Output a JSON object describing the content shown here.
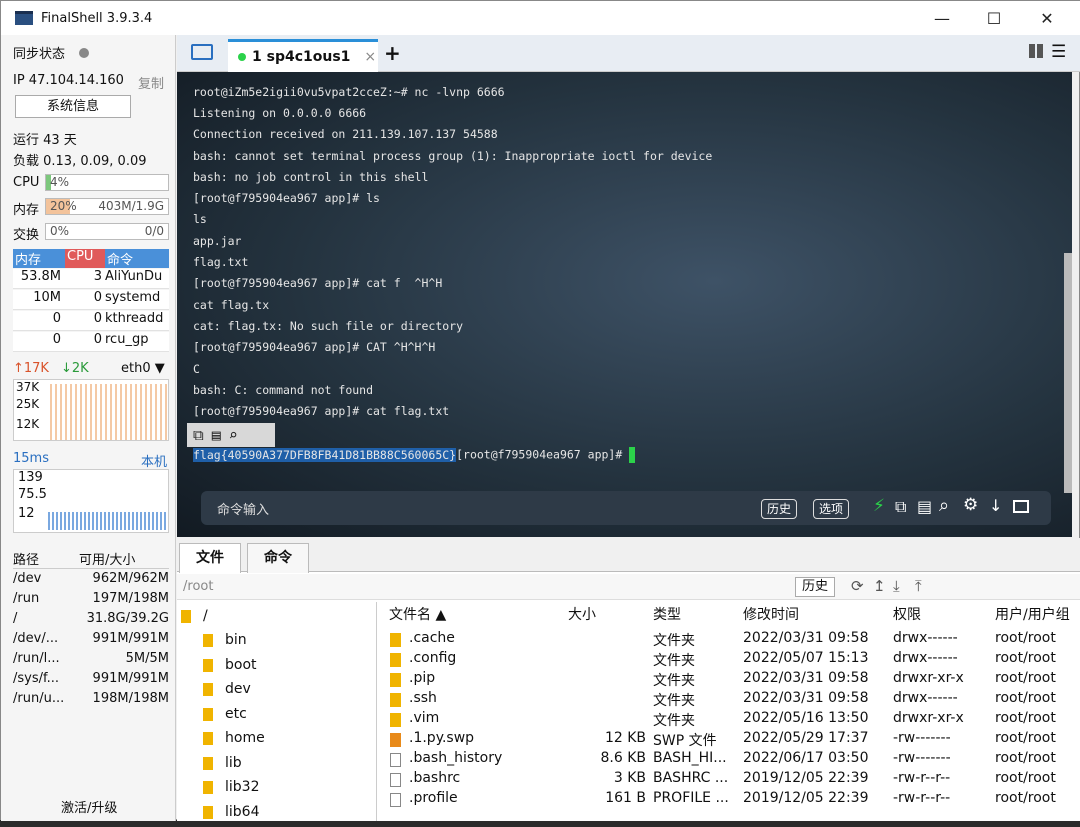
{
  "window": {
    "title": "FinalShell 3.9.3.4",
    "minimize": "—",
    "maximize": "☐",
    "close": "✕"
  },
  "left": {
    "sync_label": "同步状态",
    "ip": "IP 47.104.14.160",
    "copy_label": "复制",
    "sysinfo_button": "系统信息",
    "uptime": "运行 43 天",
    "load": "负载 0.13, 0.09, 0.09",
    "cpu_label": "CPU",
    "cpu_value": "4%",
    "cpu_fraction": 0.04,
    "mem_label": "内存",
    "mem_percent": "20%",
    "mem_usage": "403M/1.9G",
    "mem_fraction": 0.2,
    "swap_label": "交换",
    "swap_percent": "0%",
    "swap_usage": "0/0",
    "proc_headers": [
      "内存",
      "CPU",
      "命令"
    ],
    "processes": [
      {
        "mem": "53.8M",
        "cpu": "3",
        "cmd": "AliYunDu"
      },
      {
        "mem": "10M",
        "cpu": "0",
        "cmd": "systemd"
      },
      {
        "mem": "0",
        "cpu": "0",
        "cmd": "kthreadd"
      },
      {
        "mem": "0",
        "cpu": "0",
        "cmd": "rcu_gp"
      }
    ],
    "net_up": "↑17K",
    "net_down": "↓2K",
    "net_iface": "eth0",
    "net_ticks": [
      "37K",
      "25K",
      "12K"
    ],
    "latency": "15ms",
    "latency_target": "本机",
    "latency_ticks": [
      "139",
      "75.5",
      "12"
    ],
    "disk_headers": [
      "路径",
      "可用/大小"
    ],
    "disks": [
      {
        "path": "/dev",
        "size": "962M/962M"
      },
      {
        "path": "/run",
        "size": "197M/198M"
      },
      {
        "path": "/",
        "size": "31.8G/39.2G"
      },
      {
        "path": "/dev/...",
        "size": "991M/991M"
      },
      {
        "path": "/run/l...",
        "size": "5M/5M"
      },
      {
        "path": "/sys/f...",
        "size": "991M/991M"
      },
      {
        "path": "/run/u...",
        "size": "198M/198M"
      }
    ],
    "activate_label": "激活/升级"
  },
  "tabs": [
    {
      "label": "1 sp4c1ous1"
    }
  ],
  "terminal": {
    "lines": [
      "root@iZm5e2igii0vu5vpat2cceZ:~# nc -lvnp 6666",
      "Listening on 0.0.0.0 6666",
      "Connection received on 211.139.107.137 54588",
      "bash: cannot set terminal process group (1): Inappropriate ioctl for device",
      "bash: no job control in this shell",
      "[root@f795904ea967 app]# ls",
      "ls",
      "app.jar",
      "flag.txt",
      "[root@f795904ea967 app]# cat f  ^H^H",
      "cat flag.tx",
      "cat: flag.tx: No such file or directory",
      "[root@f795904ea967 app]# CAT ^H^H^H",
      "C",
      "bash: C: command not found",
      "[root@f795904ea967 app]# cat flag.txt"
    ],
    "flag": "flag{40590A377DFB8FB41D81BB88C560065C}",
    "prompt_tail": "[root@f795904ea967 app]# ",
    "command_input_label": "命令输入",
    "history_button": "历史",
    "options_button": "选项"
  },
  "filepane": {
    "tabs": [
      "文件",
      "命令"
    ],
    "path": "/root",
    "history_button": "历史",
    "tree": [
      "/",
      "bin",
      "boot",
      "dev",
      "etc",
      "home",
      "lib",
      "lib32",
      "lib64"
    ],
    "headers": [
      "文件名 ▲",
      "大小",
      "类型",
      "修改时间",
      "权限",
      "用户/用户组"
    ],
    "files": [
      {
        "name": ".cache",
        "size": "",
        "type": "文件夹",
        "mtime": "2022/03/31 09:58",
        "perm": "drwx------",
        "owner": "root/root",
        "icon": "folder-icon"
      },
      {
        "name": ".config",
        "size": "",
        "type": "文件夹",
        "mtime": "2022/05/07 15:13",
        "perm": "drwx------",
        "owner": "root/root",
        "icon": "folder-icon"
      },
      {
        "name": ".pip",
        "size": "",
        "type": "文件夹",
        "mtime": "2022/03/31 09:58",
        "perm": "drwxr-xr-x",
        "owner": "root/root",
        "icon": "folder-icon"
      },
      {
        "name": ".ssh",
        "size": "",
        "type": "文件夹",
        "mtime": "2022/03/31 09:58",
        "perm": "drwx------",
        "owner": "root/root",
        "icon": "folder-icon"
      },
      {
        "name": ".vim",
        "size": "",
        "type": "文件夹",
        "mtime": "2022/05/16 13:50",
        "perm": "drwxr-xr-x",
        "owner": "root/root",
        "icon": "folder-icon"
      },
      {
        "name": ".1.py.swp",
        "size": "12 KB",
        "type": "SWP 文件",
        "mtime": "2022/05/29 17:37",
        "perm": "-rw-------",
        "owner": "root/root",
        "icon": "swp-file-icon"
      },
      {
        "name": ".bash_history",
        "size": "8.6 KB",
        "type": "BASH_HI...",
        "mtime": "2022/06/17 03:50",
        "perm": "-rw-------",
        "owner": "root/root",
        "icon": "file-icon"
      },
      {
        "name": ".bashrc",
        "size": "3 KB",
        "type": "BASHRC ...",
        "mtime": "2019/12/05 22:39",
        "perm": "-rw-r--r--",
        "owner": "root/root",
        "icon": "file-icon"
      },
      {
        "name": ".profile",
        "size": "161 B",
        "type": "PROFILE ...",
        "mtime": "2019/12/05 22:39",
        "perm": "-rw-r--r--",
        "owner": "root/root",
        "icon": "file-icon"
      }
    ]
  },
  "colors": {
    "accent": "#2a8fd8",
    "proc_head_mem": "#4a90d9",
    "proc_head_cpu": "#e05a5a",
    "flag_highlight": "#1f5fa8",
    "cursor": "#2bd24a"
  }
}
